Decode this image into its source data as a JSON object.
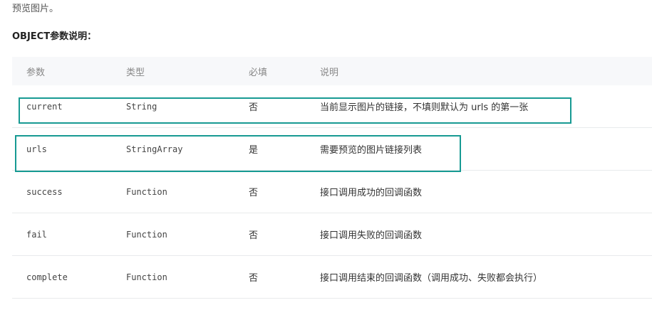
{
  "intro_text": "预览图片。",
  "section_title": "OBJECT参数说明：",
  "table": {
    "headers": {
      "name": "参数",
      "type": "类型",
      "required": "必填",
      "description": "说明"
    },
    "rows": [
      {
        "name": "current",
        "type": "String",
        "required": "否",
        "description": "当前显示图片的链接，不填则默认为 urls 的第一张"
      },
      {
        "name": "urls",
        "type": "StringArray",
        "required": "是",
        "description": "需要预览的图片链接列表"
      },
      {
        "name": "success",
        "type": "Function",
        "required": "否",
        "description": "接口调用成功的回调函数"
      },
      {
        "name": "fail",
        "type": "Function",
        "required": "否",
        "description": "接口调用失败的回调函数"
      },
      {
        "name": "complete",
        "type": "Function",
        "required": "否",
        "description": "接口调用结束的回调函数（调用成功、失败都会执行）"
      }
    ]
  },
  "colors": {
    "highlight_border": "#179a93",
    "header_background": "#f7f8fa",
    "row_divider": "#e8eaec"
  }
}
